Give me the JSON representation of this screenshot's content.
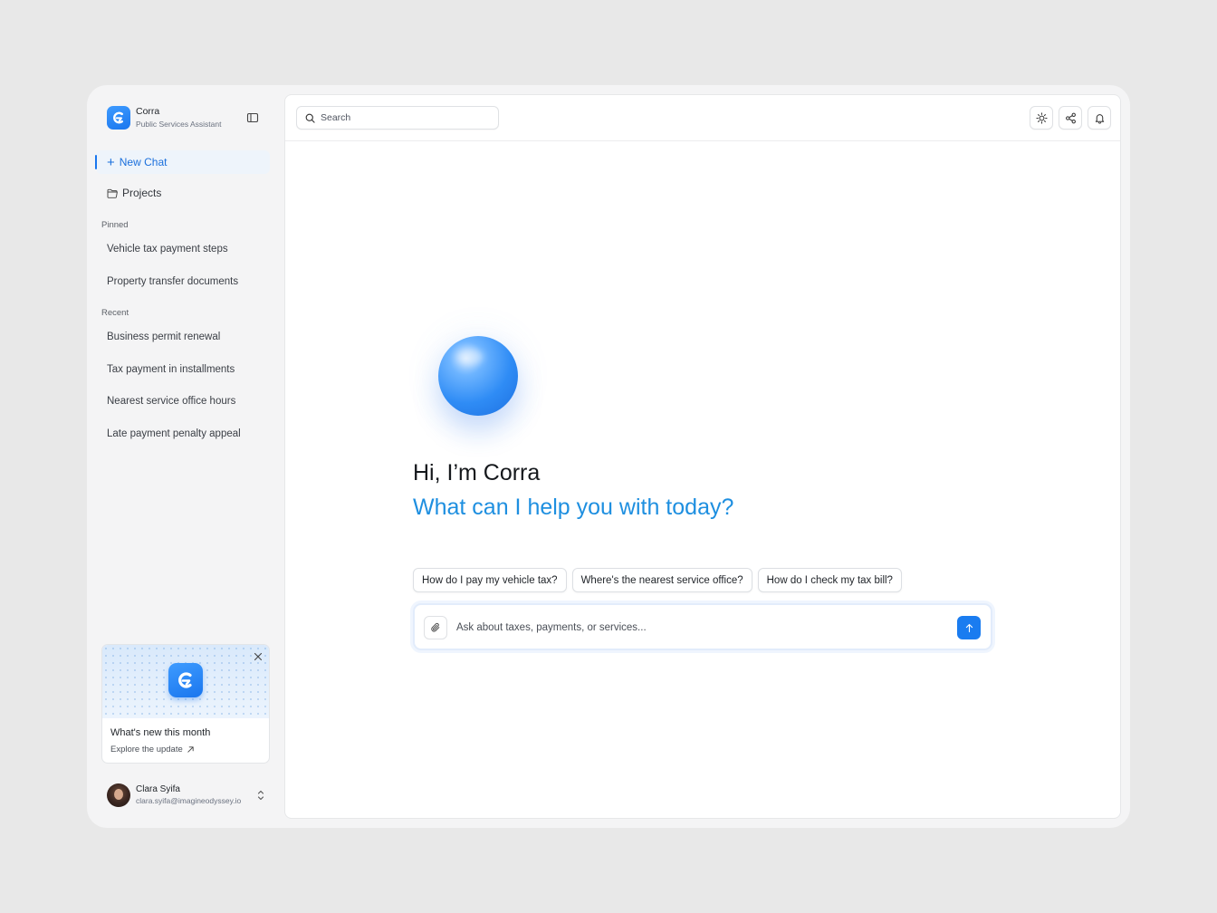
{
  "brand": {
    "name": "Corra",
    "subtitle": "Public Services Assistant"
  },
  "sidebar": {
    "new_chat_label": "New Chat",
    "projects_label": "Projects",
    "pinned_label": "Pinned",
    "pinned_items": [
      {
        "label": "Vehicle tax payment steps"
      },
      {
        "label": "Property transfer documents"
      }
    ],
    "recent_label": "Recent",
    "recent_items": [
      {
        "label": "Business permit renewal"
      },
      {
        "label": "Tax payment in installments"
      },
      {
        "label": "Nearest service office hours"
      },
      {
        "label": "Late payment penalty appeal"
      }
    ]
  },
  "promo": {
    "title": "What's new this month",
    "link_label": "Explore the update"
  },
  "user": {
    "name": "Clara Syifa",
    "email": "clara.syifa@imagineodyssey.io"
  },
  "topbar": {
    "search_placeholder": "Search"
  },
  "main": {
    "greeting": "Hi, I’m Corra",
    "headline": "What can I help you with today?",
    "suggestions": [
      {
        "label": "How do I pay my vehicle tax?"
      },
      {
        "label": "Where's the nearest service office?"
      },
      {
        "label": "How do I check my tax bill?"
      }
    ],
    "composer_placeholder": "Ask about taxes, payments, or services..."
  },
  "colors": {
    "accent": "#1a7cf0",
    "headline": "#1e8fe0",
    "sidebar_bg": "#f4f4f5"
  },
  "icons": [
    "sidebar-toggle-icon",
    "plus-icon",
    "folder-icon",
    "close-icon",
    "arrow-up-right-icon",
    "chevron-up-down-icon",
    "search-icon",
    "sun-icon",
    "share-icon",
    "bell-icon",
    "paperclip-icon",
    "arrow-up-icon"
  ]
}
